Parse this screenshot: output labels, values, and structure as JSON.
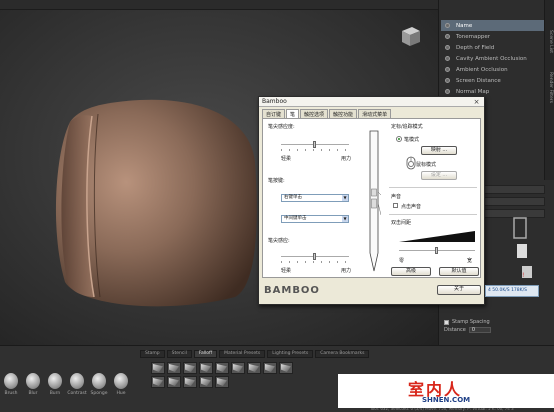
{
  "render_filters": {
    "items": [
      {
        "label": "Name",
        "selected": true
      },
      {
        "label": "Tonemapper",
        "selected": false
      },
      {
        "label": "Depth of Field",
        "selected": false
      },
      {
        "label": "Cavity Ambient Occlusion",
        "selected": false
      },
      {
        "label": "Ambient Occlusion",
        "selected": false
      },
      {
        "label": "Screen Distance",
        "selected": false
      },
      {
        "label": "Normal Map",
        "selected": false
      }
    ]
  },
  "side_tabs": [
    "Scene List",
    "Render Filters"
  ],
  "stamp_options": {
    "stamp_spacing_label": "Stamp Spacing",
    "distance_label": "Distance",
    "distance_value": "0"
  },
  "shelf": {
    "tabs": [
      "Stamp",
      "Stencil",
      "Falloff",
      "Material Presets",
      "Lighting Presets",
      "Camera Bookmarks"
    ],
    "active_tab": "Falloff",
    "tools": [
      "Brush",
      "Blur",
      "Burn",
      "Contrast",
      "Sponge",
      "Hue"
    ],
    "thumb_count": 14,
    "status_text": "Tool: 632, Selected: 0 (3/4) Move: 756, Memory: P: Virtual: 5 K: 00, 74 3"
  },
  "dialog": {
    "title": "Bamboo",
    "close_label": "×",
    "tabs": [
      "自订键",
      "笔",
      "触控选项",
      "触控功能",
      "滑动式菜单"
    ],
    "active_tab": "笔",
    "tip_feel_label": "笔尖感应度:",
    "tip_feel_left": "轻柔",
    "tip_feel_right": "用力",
    "tip_feel_level": 0.5,
    "side_switch_label": "笔按键:",
    "upper_button_value": "右键单击",
    "lower_button_value": "中间键单击",
    "eraser_feel_label": "笔尖感应:",
    "eraser_feel_left": "轻柔",
    "eraser_feel_right": "用力",
    "eraser_feel_level": 0.5,
    "tracking_label": "定标/追踪模式",
    "pen_mode_label": "笔模式",
    "mapping_button": "映射 ...",
    "mouse_mode_label": "鼠标模式",
    "mouse_settings_button": "设定 ...",
    "sound_label": "声音",
    "sound_checkbox_label": "点击声音",
    "double_click_label": "双击间距",
    "double_click_left": "零",
    "double_click_right": "宽",
    "double_click_level": 0.5,
    "advanced_button": "高级",
    "default_button": "默认值",
    "about_button": "关于",
    "logo_text": "BAMBOO",
    "readout_text": "4 50.0K/S  178K/S"
  },
  "watermark": {
    "title": "室内人",
    "url": "SHNEN.COM"
  },
  "colors": {
    "pillow": "#8a6a58",
    "dialog_bg": "#ece9d8",
    "selected_filter": "#5c6a78",
    "watermark_red": "#d8261a"
  }
}
